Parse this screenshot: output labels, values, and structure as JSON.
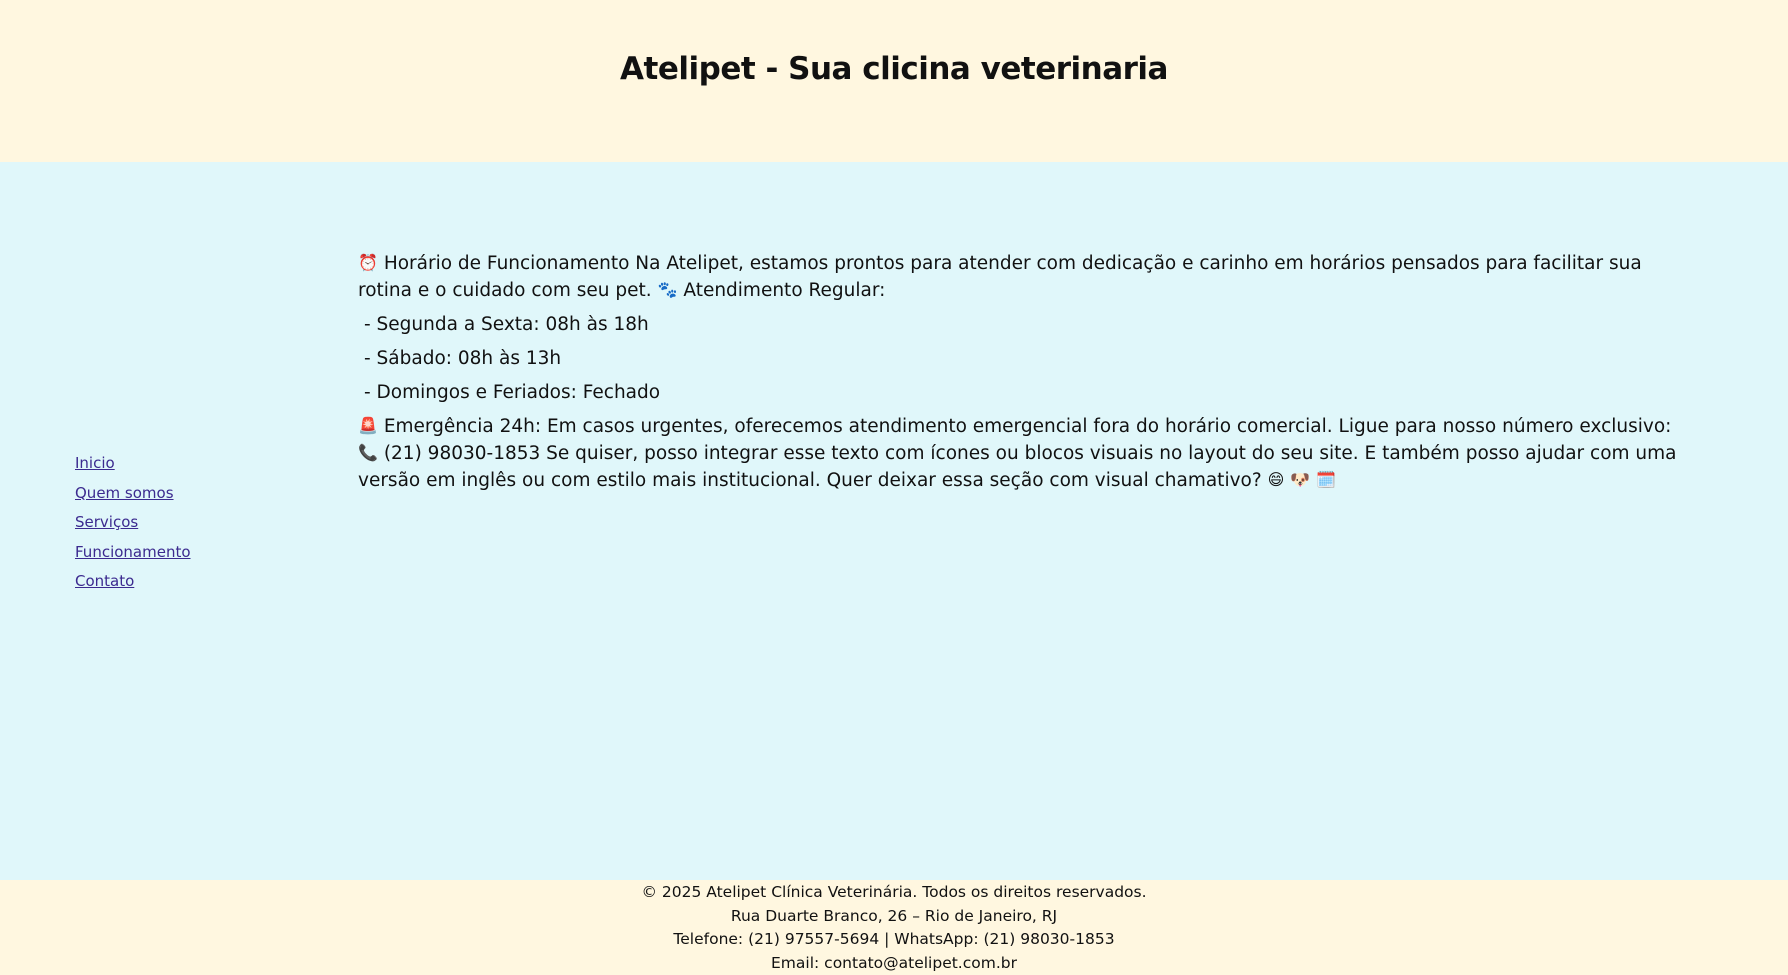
{
  "header": {
    "title": "Atelipet - Sua clicina veterinaria"
  },
  "nav": {
    "items": [
      {
        "label": "Inicio"
      },
      {
        "label": "Quem somos"
      },
      {
        "label": "Serviços"
      },
      {
        "label": "Funcionamento"
      },
      {
        "label": "Contato"
      }
    ]
  },
  "main": {
    "intro_icon": "⏰",
    "intro_text": "Horário de Funcionamento Na Atelipet, estamos prontos para atender com dedicação e carinho em horários pensados para facilitar sua rotina e o cuidado com seu pet.",
    "paw_icon": "🐾",
    "regular_text": "Atendimento Regular:",
    "hours": [
      " - Segunda a Sexta: 08h às 18h",
      " - Sábado: 08h às 13h",
      " - Domingos e Feriados: Fechado"
    ],
    "emergency_icon": "🚨",
    "emergency_text": "Emergência 24h: Em casos urgentes, oferecemos atendimento emergencial fora do horário comercial. Ligue para nosso número exclusivo:",
    "phone_icon": "📞",
    "emergency_text2": "(21) 98030-1853 Se quiser, posso integrar esse texto com ícones ou blocos visuais no layout do seu site. E também posso ajudar com uma versão em inglês ou com estilo mais institucional. Quer deixar essa seção com visual chamativo?",
    "end_icons": [
      "😄",
      "🐶",
      "🗓️"
    ]
  },
  "footer": {
    "copyright": "© 2025 Atelipet Clínica Veterinária. Todos os direitos reservados.",
    "address": "Rua Duarte Branco, 26 – Rio de Janeiro, RJ",
    "phone": "Telefone: (21) 97557-5694 | WhatsApp: (21) 98030-1853",
    "email": "Email: contato@atelipet.com.br"
  },
  "colors": {
    "header_bg": "#fff7e0",
    "content_bg": "#e0f7fa",
    "link": "#3b2a8f"
  }
}
